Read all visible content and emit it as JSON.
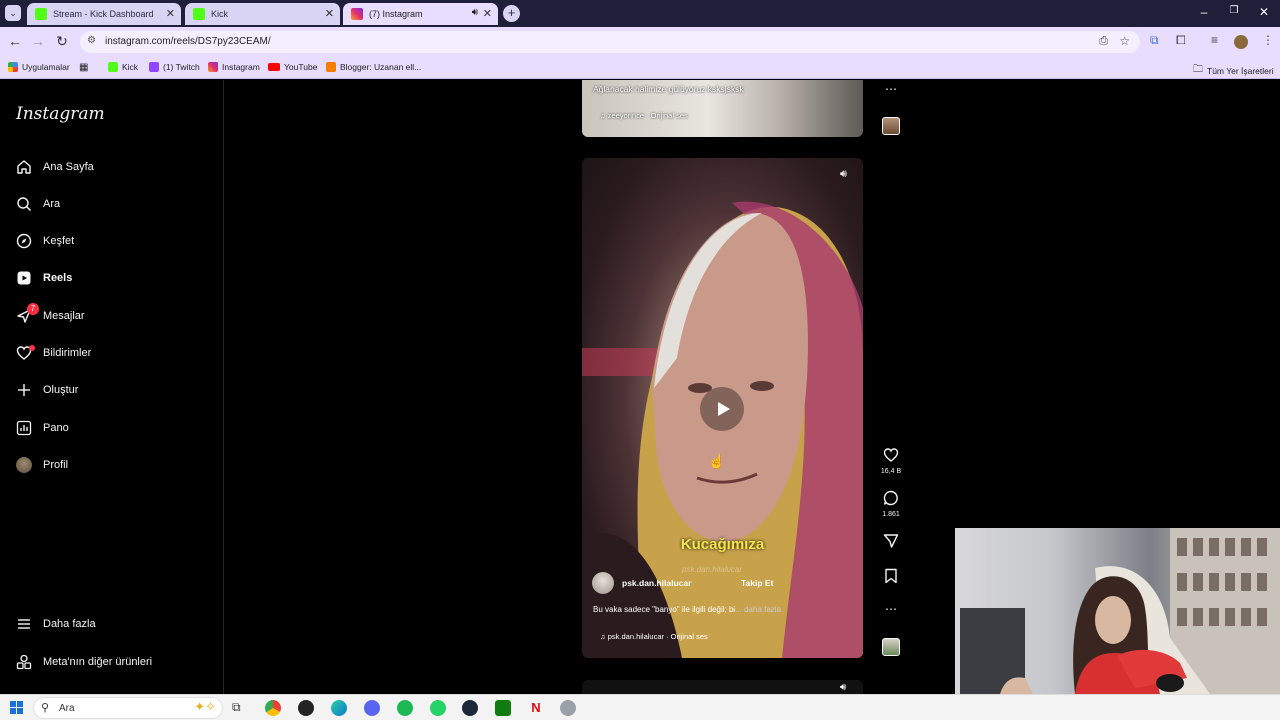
{
  "browser": {
    "tabs": [
      {
        "title": "Stream - Kick Dashboard",
        "favicon": "kick-icon",
        "color": "#53fc18"
      },
      {
        "title": "Kick",
        "favicon": "kick-icon",
        "color": "#53fc18"
      },
      {
        "title": "(7) Instagram",
        "favicon": "instagram-icon",
        "color": "#e1306c"
      }
    ],
    "url": "instagram.com/reels/DS7py23CEAM/",
    "bookmarks": [
      {
        "label": "Uygulamalar",
        "icon": "apps-icon"
      },
      {
        "label": "",
        "icon": "grid-icon"
      },
      {
        "label": "Kick",
        "icon": "kick-icon"
      },
      {
        "label": "(1) Twitch",
        "icon": "twitch-icon"
      },
      {
        "label": "Instagram",
        "icon": "instagram-icon"
      },
      {
        "label": "YouTube",
        "icon": "youtube-icon"
      },
      {
        "label": "Blogger: Uzanan ell...",
        "icon": "blogger-icon"
      }
    ],
    "all_bookmarks": "Tüm Yer İşaretleri"
  },
  "instagram": {
    "logo": "Instagram",
    "nav": [
      {
        "label": "Ana Sayfa",
        "icon": "home-icon"
      },
      {
        "label": "Ara",
        "icon": "search-icon"
      },
      {
        "label": "Keşfet",
        "icon": "compass-icon"
      },
      {
        "label": "Reels",
        "icon": "reels-icon"
      },
      {
        "label": "Mesajlar",
        "icon": "messenger-icon",
        "badge": "7"
      },
      {
        "label": "Bildirimler",
        "icon": "heart-icon"
      },
      {
        "label": "Oluştur",
        "icon": "plus-icon"
      },
      {
        "label": "Pano",
        "icon": "dashboard-icon"
      },
      {
        "label": "Profil",
        "icon": "avatar-icon"
      }
    ],
    "more": "Daha fazla",
    "meta": "Meta'nın diğer ürünleri"
  },
  "reel_top": {
    "caption": "Ağlanacak halimize gülüyoruz ksksjsksk",
    "audio": "zeeyonnce · Orijinal ses"
  },
  "reel_main": {
    "subtitle": "Kucağımıza",
    "watermark": "psk.dan.hilalucar",
    "username": "psk.dan.hilalucar",
    "follow": "Takip Et",
    "caption": "Bu vaka sadece \"banyo\" ile ilgili değil; bi",
    "more": "... daha fazla",
    "audio": "psk.dan.hilalucar · Orijinal ses",
    "likes": "16,4 B",
    "comments": "1.861"
  },
  "taskbar": {
    "search": "Ara"
  }
}
